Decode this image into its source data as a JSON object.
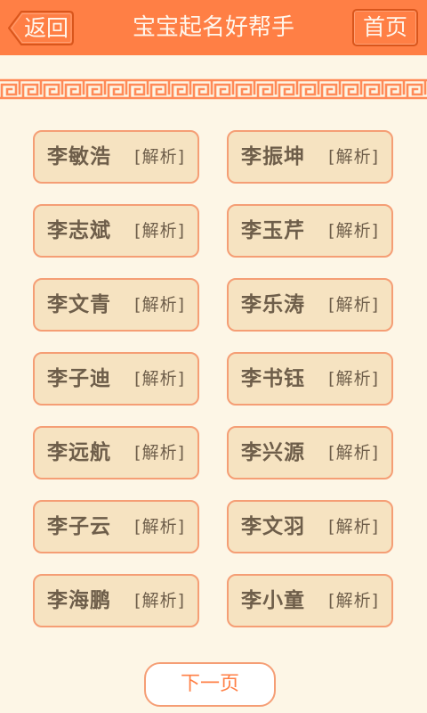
{
  "header": {
    "title": "宝宝起名好帮手",
    "back_label": "返回",
    "home_label": "首页"
  },
  "names": [
    {
      "name": "李敏浩",
      "analyze": "[解析]"
    },
    {
      "name": "李振坤",
      "analyze": "[解析]"
    },
    {
      "name": "李志斌",
      "analyze": "[解析]"
    },
    {
      "name": "李玉芹",
      "analyze": "[解析]"
    },
    {
      "name": "李文青",
      "analyze": "[解析]"
    },
    {
      "name": "李乐涛",
      "analyze": "[解析]"
    },
    {
      "name": "李子迪",
      "analyze": "[解析]"
    },
    {
      "name": "李书钰",
      "analyze": "[解析]"
    },
    {
      "name": "李远航",
      "analyze": "[解析]"
    },
    {
      "name": "李兴源",
      "analyze": "[解析]"
    },
    {
      "name": "李子云",
      "analyze": "[解析]"
    },
    {
      "name": "李文羽",
      "analyze": "[解析]"
    },
    {
      "name": "李海鹏",
      "analyze": "[解析]"
    },
    {
      "name": "李小童",
      "analyze": "[解析]"
    }
  ],
  "footer": {
    "next_label": "下一页"
  },
  "colors": {
    "header_bg": "#FF7F45",
    "page_bg": "#FDF6E6",
    "card_bg": "#F6E3C1",
    "card_border": "#F59E75",
    "text": "#6E5E4A"
  }
}
